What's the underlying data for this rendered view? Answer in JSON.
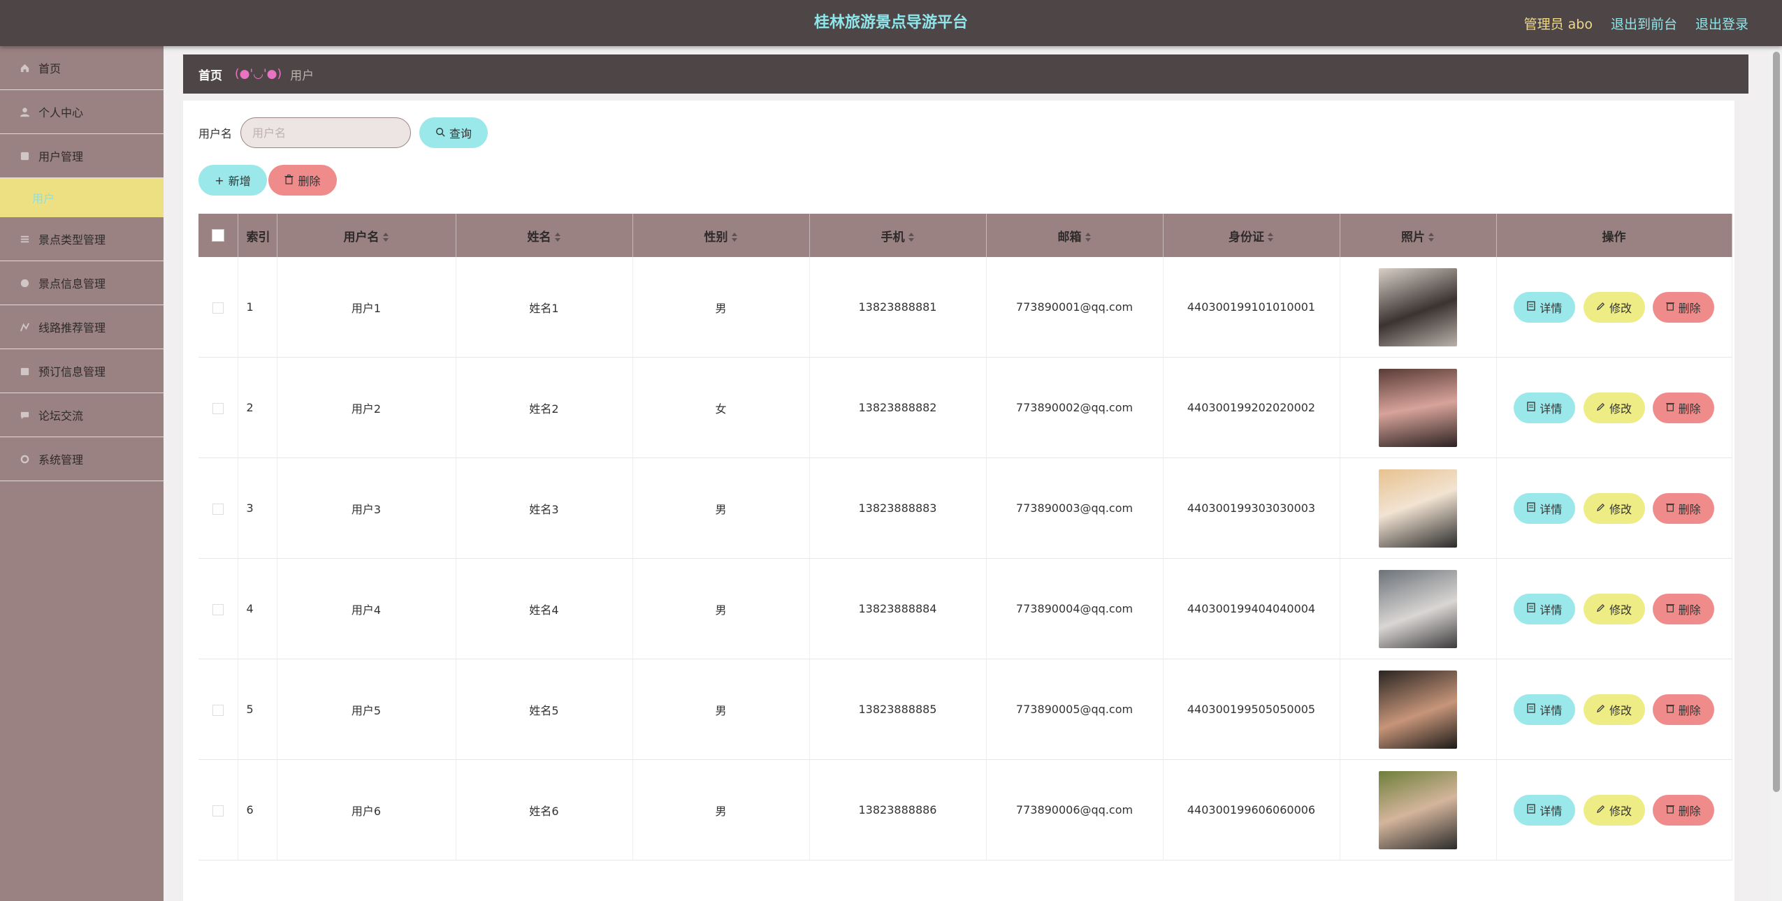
{
  "header": {
    "title": "桂林旅游景点导游平台",
    "admin": "管理员 abo",
    "to_front": "退出到前台",
    "logout": "退出登录"
  },
  "sidebar": {
    "items": [
      {
        "label": "首页",
        "icon": "home-icon"
      },
      {
        "label": "个人中心",
        "icon": "user-icon"
      },
      {
        "label": "用户管理",
        "icon": "users-icon"
      },
      {
        "label": "用户",
        "icon": "",
        "sub": true
      },
      {
        "label": "景点类型管理",
        "icon": "list-icon"
      },
      {
        "label": "景点信息管理",
        "icon": "info-icon"
      },
      {
        "label": "线路推荐管理",
        "icon": "route-icon"
      },
      {
        "label": "预订信息管理",
        "icon": "booking-icon"
      },
      {
        "label": "论坛交流",
        "icon": "forum-icon"
      },
      {
        "label": "系统管理",
        "icon": "settings-icon"
      }
    ]
  },
  "breadcrumb": {
    "home": "首页",
    "sep": "(●'◡'●)",
    "current": "用户"
  },
  "search": {
    "label": "用户名",
    "placeholder": "用户名",
    "button": "查询"
  },
  "actions": {
    "add": "新增",
    "delete": "删除"
  },
  "table": {
    "columns": [
      "索引",
      "用户名",
      "姓名",
      "性别",
      "手机",
      "邮箱",
      "身份证",
      "照片",
      "操作"
    ],
    "ops": {
      "detail": "详情",
      "edit": "修改",
      "delete": "删除"
    },
    "rows": [
      {
        "idx": "1",
        "username": "用户1",
        "name": "姓名1",
        "gender": "男",
        "phone": "13823888881",
        "email": "773890001@qq.com",
        "idcard": "440300199101010001"
      },
      {
        "idx": "2",
        "username": "用户2",
        "name": "姓名2",
        "gender": "女",
        "phone": "13823888882",
        "email": "773890002@qq.com",
        "idcard": "440300199202020002"
      },
      {
        "idx": "3",
        "username": "用户3",
        "name": "姓名3",
        "gender": "男",
        "phone": "13823888883",
        "email": "773890003@qq.com",
        "idcard": "440300199303030003"
      },
      {
        "idx": "4",
        "username": "用户4",
        "name": "姓名4",
        "gender": "男",
        "phone": "13823888884",
        "email": "773890004@qq.com",
        "idcard": "440300199404040004"
      },
      {
        "idx": "5",
        "username": "用户5",
        "name": "姓名5",
        "gender": "男",
        "phone": "13823888885",
        "email": "773890005@qq.com",
        "idcard": "440300199505050005"
      },
      {
        "idx": "6",
        "username": "用户6",
        "name": "姓名6",
        "gender": "男",
        "phone": "13823888886",
        "email": "773890006@qq.com",
        "idcard": "440300199606060006"
      }
    ]
  },
  "colors": {
    "header_bg": "#4e4646",
    "title": "#8fe6ea",
    "sidebar_bg": "#9a8282",
    "sub_active_bg": "#ede082",
    "btn_cyan": "#9be8ea",
    "btn_yellow": "#eeec85",
    "btn_red": "#f08b8b"
  }
}
